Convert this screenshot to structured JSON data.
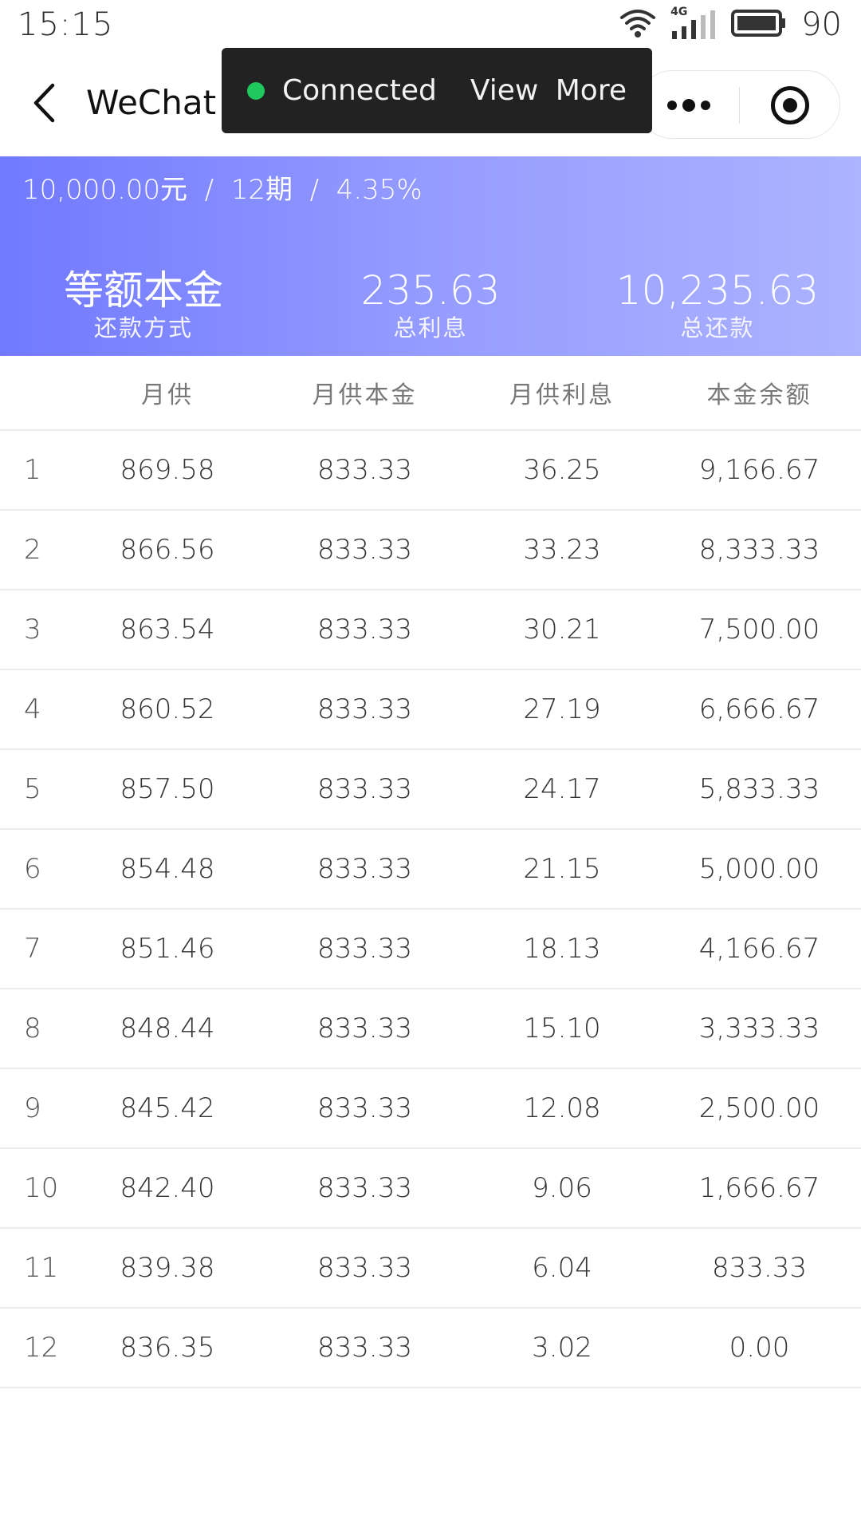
{
  "status_bar": {
    "time": "15:15",
    "network": "4G",
    "battery": "90",
    "icons": [
      "wifi-icon",
      "signal-icon",
      "battery-icon"
    ]
  },
  "header": {
    "title": "WeChat",
    "back_icon": "chevron-left-icon",
    "more_icon": "more-dots-icon",
    "close_icon": "close-target-icon"
  },
  "toast": {
    "status": "Connected",
    "link": "View More",
    "dot_color": "#1ec85c"
  },
  "banner": {
    "summary": "10,000.00元  /  12期  /  4.35%",
    "gradient": [
      "#7179ff",
      "#acb3ff"
    ],
    "stats": [
      {
        "value": "等额本金",
        "label": "还款方式"
      },
      {
        "value": "235.63",
        "label": "总利息"
      },
      {
        "value": "10,235.63",
        "label": "总还款"
      }
    ]
  },
  "table": {
    "headers": [
      "",
      "月供",
      "月供本金",
      "月供利息",
      "本金余额"
    ],
    "rows": [
      [
        "1",
        "869.58",
        "833.33",
        "36.25",
        "9,166.67"
      ],
      [
        "2",
        "866.56",
        "833.33",
        "33.23",
        "8,333.33"
      ],
      [
        "3",
        "863.54",
        "833.33",
        "30.21",
        "7,500.00"
      ],
      [
        "4",
        "860.52",
        "833.33",
        "27.19",
        "6,666.67"
      ],
      [
        "5",
        "857.50",
        "833.33",
        "24.17",
        "5,833.33"
      ],
      [
        "6",
        "854.48",
        "833.33",
        "21.15",
        "5,000.00"
      ],
      [
        "7",
        "851.46",
        "833.33",
        "18.13",
        "4,166.67"
      ],
      [
        "8",
        "848.44",
        "833.33",
        "15.10",
        "3,333.33"
      ],
      [
        "9",
        "845.42",
        "833.33",
        "12.08",
        "2,500.00"
      ],
      [
        "10",
        "842.40",
        "833.33",
        "9.06",
        "1,666.67"
      ],
      [
        "11",
        "839.38",
        "833.33",
        "6.04",
        "833.33"
      ],
      [
        "12",
        "836.35",
        "833.33",
        "3.02",
        "0.00"
      ]
    ]
  }
}
